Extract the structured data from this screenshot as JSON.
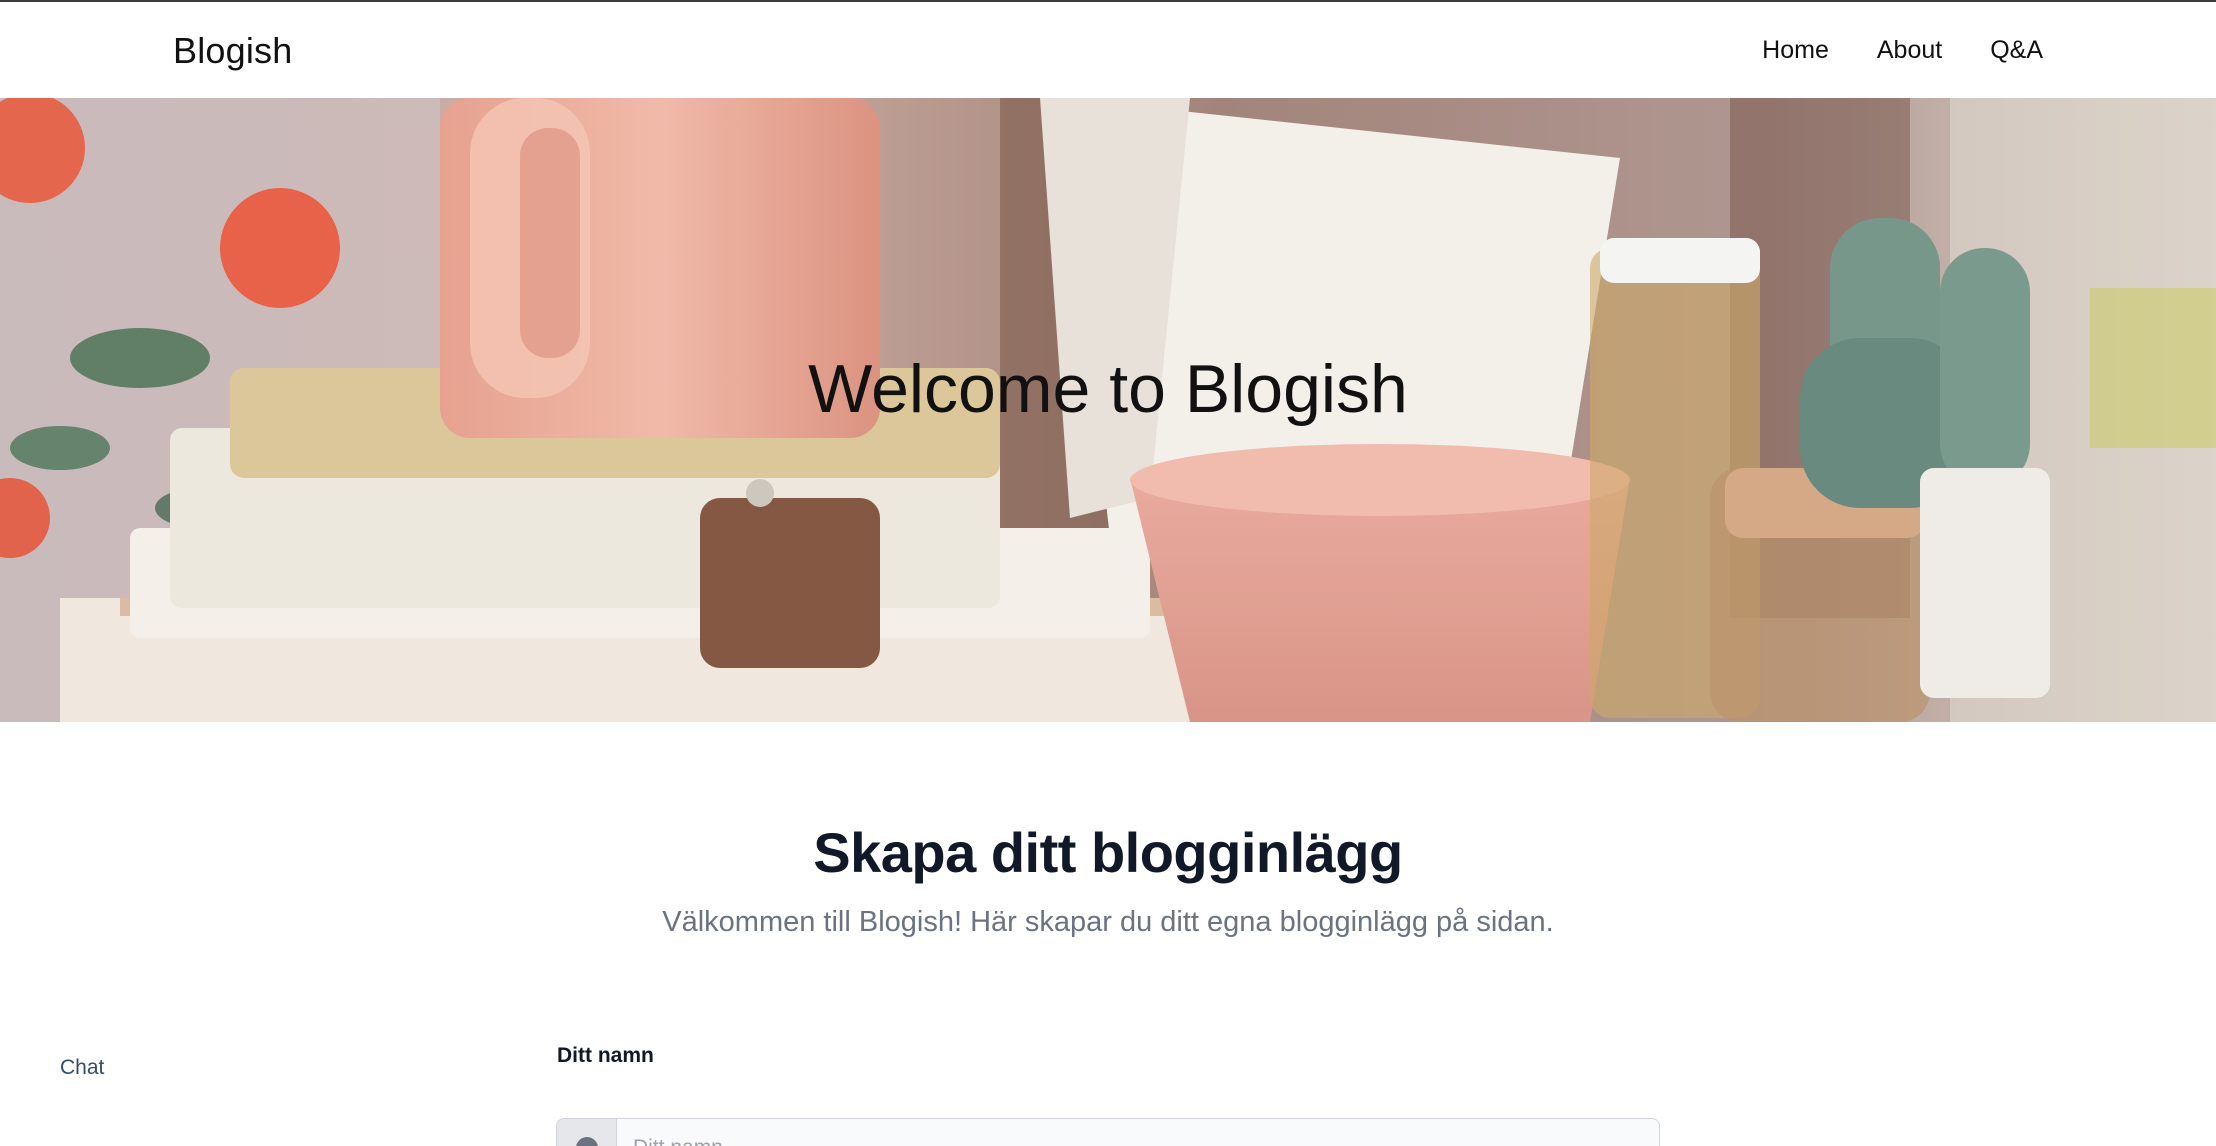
{
  "navbar": {
    "brand": "Blogish",
    "links": [
      {
        "label": "Home"
      },
      {
        "label": "About"
      },
      {
        "label": "Q&A"
      }
    ]
  },
  "hero": {
    "title": "Welcome to Blogish"
  },
  "section": {
    "title": "Skapa ditt blogginlägg",
    "subtitle": "Välkommen till Blogish! Här skapar du ditt egna blogginlägg på sidan."
  },
  "chat": {
    "label": "Chat"
  },
  "form": {
    "name_label": "Ditt namn",
    "name_placeholder": "Ditt namn",
    "name_value": ""
  },
  "colors": {
    "text_dark": "#111827",
    "subtitle_gray": "#6b7280",
    "chat_link": "#334e68"
  }
}
